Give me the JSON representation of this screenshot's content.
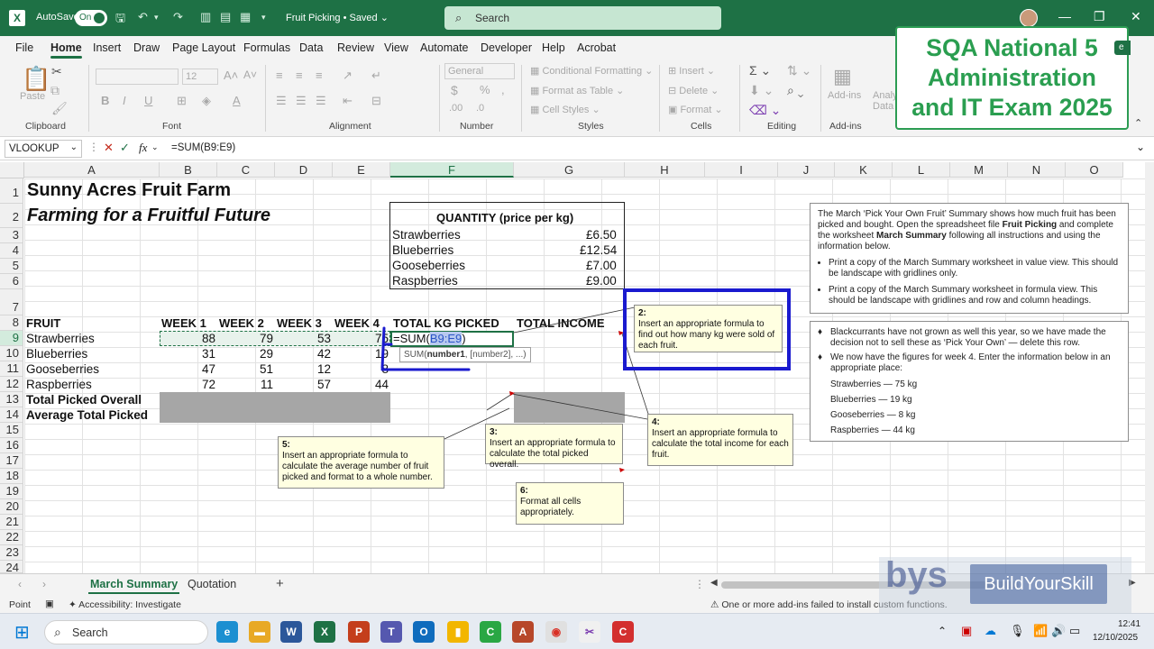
{
  "titlebar": {
    "autosave_label": "AutoSave",
    "autosave_state": "On",
    "doc_title": "Fruit Picking • Saved",
    "search_placeholder": "Search"
  },
  "menu": [
    "File",
    "Home",
    "Insert",
    "Draw",
    "Page Layout",
    "Formulas",
    "Data",
    "Review",
    "View",
    "Automate",
    "Developer",
    "Help",
    "Acrobat"
  ],
  "ribbon": {
    "font_size": "12",
    "number_format": "General",
    "paste": "Paste",
    "conditional_formatting": "Conditional Formatting",
    "format_as_table": "Format as Table",
    "cell_styles": "Cell Styles",
    "insert": "Insert",
    "delete": "Delete",
    "format": "Format",
    "addins": "Add-ins",
    "analyze_line1": "Analy",
    "analyze_line2": "Data",
    "groups": [
      "Clipboard",
      "Font",
      "Alignment",
      "Number",
      "Styles",
      "Cells",
      "Editing",
      "Add-ins"
    ]
  },
  "callout": {
    "line1": "SQA National 5",
    "line2": "Administration",
    "line3": "and IT Exam 2025"
  },
  "formula_bar": {
    "name_box": "VLOOKUP",
    "fx": "fx",
    "formula": "=SUM(B9:E9)"
  },
  "columns": [
    "A",
    "B",
    "C",
    "D",
    "E",
    "F",
    "G",
    "H",
    "I",
    "J",
    "K",
    "L",
    "M",
    "N",
    "O"
  ],
  "rows": [
    "1",
    "2",
    "3",
    "4",
    "5",
    "6",
    "7",
    "8",
    "9",
    "10",
    "11",
    "12",
    "13",
    "14",
    "15",
    "16",
    "17",
    "18",
    "19",
    "20",
    "21",
    "22",
    "23",
    "24"
  ],
  "sheet": {
    "title": "Sunny Acres Fruit Farm",
    "subtitle": "Farming for a Fruitful Future",
    "price_box": {
      "header": "QUANTITY (price per kg)",
      "items": [
        {
          "name": "Strawberries",
          "price": "£6.50"
        },
        {
          "name": "Blueberries",
          "price": "£12.54"
        },
        {
          "name": "Gooseberries",
          "price": "£7.00"
        },
        {
          "name": "Raspberries",
          "price": "£9.00"
        }
      ]
    },
    "headers": [
      "FRUIT",
      "WEEK 1",
      "WEEK 2",
      "WEEK 3",
      "WEEK 4",
      "TOTAL KG PICKED",
      "TOTAL INCOME"
    ],
    "data": [
      {
        "fruit": "Strawberries",
        "w1": "88",
        "w2": "79",
        "w3": "53",
        "w4": "75"
      },
      {
        "fruit": "Blueberries",
        "w1": "31",
        "w2": "29",
        "w3": "42",
        "w4": "19"
      },
      {
        "fruit": "Gooseberries",
        "w1": "47",
        "w2": "51",
        "w3": "12",
        "w4": "8"
      },
      {
        "fruit": "Raspberries",
        "w1": "72",
        "w2": "11",
        "w3": "57",
        "w4": "44"
      }
    ],
    "edit_cell": {
      "prefix": "=SUM(",
      "ref": "B9:E9",
      "suffix": ")"
    },
    "tooltip": {
      "name": "SUM(",
      "arg1": "number1",
      "rest": ", [number2], ...)"
    },
    "total_label": "Total Picked Overall",
    "average_label": "Average Total Picked"
  },
  "notes": [
    {
      "num": "2:",
      "text": "Insert an appropriate formula to find out how many kg were sold of each fruit."
    },
    {
      "num": "3:",
      "text": "Insert an appropriate formula to calculate the total picked overall."
    },
    {
      "num": "4:",
      "text": "Insert an appropriate formula to calculate the total income for each fruit."
    },
    {
      "num": "5:",
      "text": "Insert an appropriate formula to calculate the average number of fruit picked and format to a whole number."
    },
    {
      "num": "6:",
      "text": "Format all cells appropriately."
    }
  ],
  "panel1": {
    "intro_a": "The March ‘Pick Your Own Fruit’ Summary shows how much fruit has been picked and bought. Open the spreadsheet file ",
    "intro_file": "Fruit Picking",
    "intro_b": " and complete the worksheet ",
    "intro_sheet": "March Summary",
    "intro_c": " following all instructions and using the information below.",
    "bullets": [
      "Print a copy of the March Summary worksheet in value view. This should be landscape with gridlines only.",
      "Print a copy of the March Summary worksheet in formula view. This should be landscape with gridlines and row and column headings."
    ]
  },
  "panel2": {
    "items": [
      "Blackcurrants have not grown as well this year, so we have made the decision not to sell these as ‘Pick Your Own’ — delete this row.",
      "We now have the figures for week 4. Enter the information below in an appropriate place:"
    ],
    "figures": [
      "Strawberries — 75 kg",
      "Blueberries — 19 kg",
      "Gooseberries — 8 kg",
      "Raspberries — 44 kg"
    ]
  },
  "tabs": [
    "March Summary",
    "Quotation"
  ],
  "status": {
    "mode": "Point",
    "accessibility": "Accessibility: Investigate",
    "addin_msg": "One or more add-ins failed to install custom functions."
  },
  "watermark": {
    "brand": "bys",
    "text": "BuildYourSkill"
  },
  "taskbar": {
    "search": "Search",
    "time": "12:41",
    "date": "12/10/2025"
  }
}
